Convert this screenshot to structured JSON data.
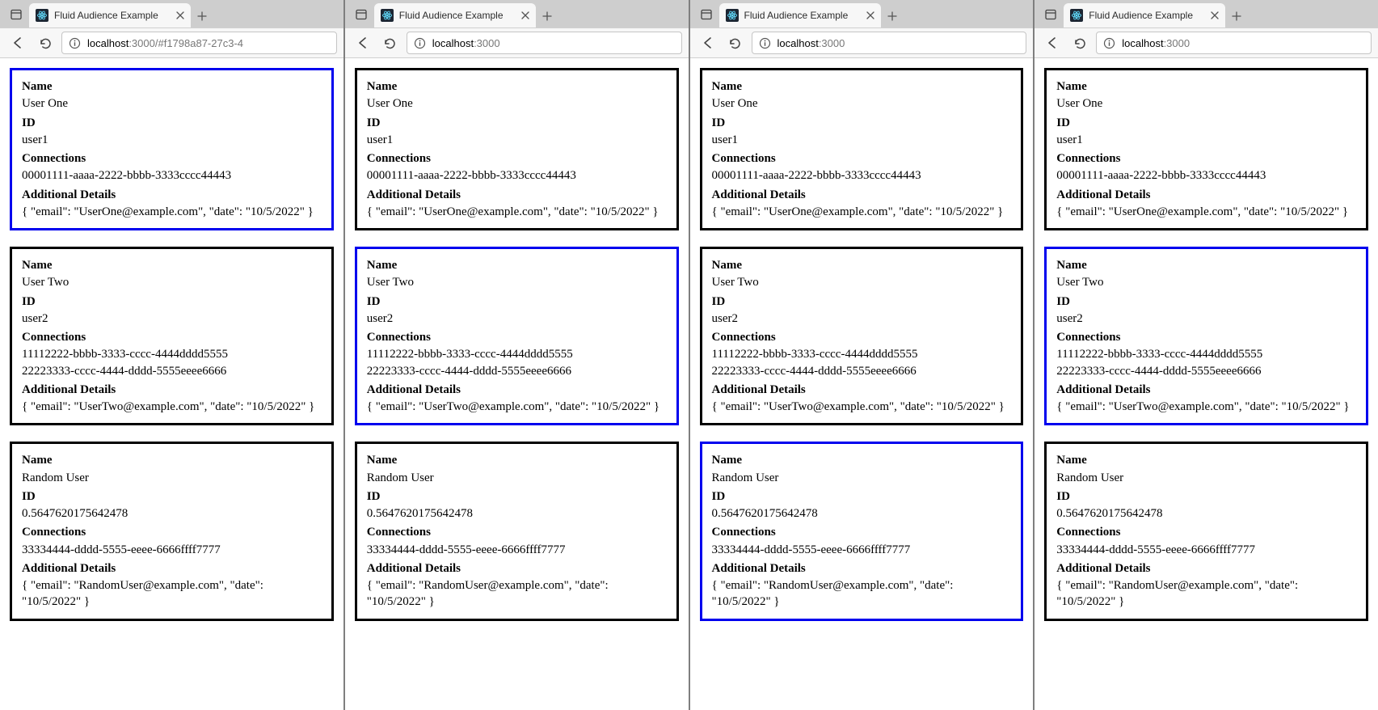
{
  "labels": {
    "name": "Name",
    "id": "ID",
    "connections": "Connections",
    "details": "Additional Details"
  },
  "common_cards": [
    {
      "name": "User One",
      "id": "user1",
      "connections": [
        "00001111-aaaa-2222-bbbb-3333cccc44443"
      ],
      "details": "{ \"email\": \"UserOne@example.com\", \"date\": \"10/5/2022\" }"
    },
    {
      "name": "User Two",
      "id": "user2",
      "connections": [
        "11112222-bbbb-3333-cccc-4444dddd5555",
        "22223333-cccc-4444-dddd-5555eeee6666"
      ],
      "details": "{ \"email\": \"UserTwo@example.com\", \"date\": \"10/5/2022\" }"
    },
    {
      "name": "Random User",
      "id": "0.5647620175642478",
      "connections": [
        "33334444-dddd-5555-eeee-6666ffff7777"
      ],
      "details": "{ \"email\": \"RandomUser@example.com\", \"date\": \"10/5/2022\" }"
    }
  ],
  "windows": [
    {
      "tab_title": "Fluid Audience Example",
      "url_host": "localhost",
      "url_port": ":3000",
      "url_rest": "/#f1798a87-27c3-4",
      "active_index": 0
    },
    {
      "tab_title": "Fluid Audience Example",
      "url_host": "localhost",
      "url_port": ":3000",
      "url_rest": "",
      "active_index": 1
    },
    {
      "tab_title": "Fluid Audience Example",
      "url_host": "localhost",
      "url_port": ":3000",
      "url_rest": "",
      "active_index": 2
    },
    {
      "tab_title": "Fluid Audience Example",
      "url_host": "localhost",
      "url_port": ":3000",
      "url_rest": "",
      "active_index": 1
    }
  ]
}
